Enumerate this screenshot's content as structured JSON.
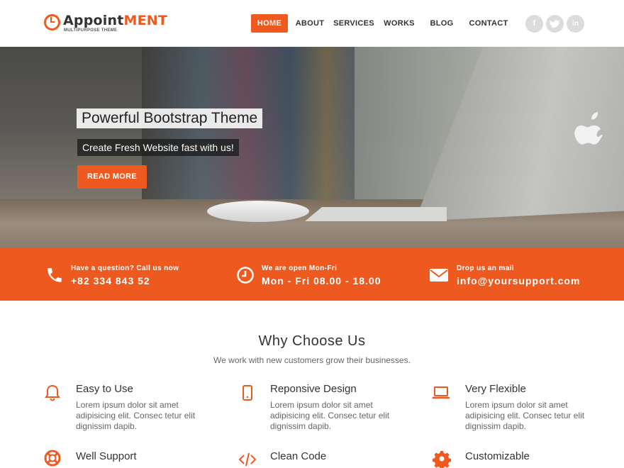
{
  "brand": {
    "name_part1": "Appoint",
    "name_part2": "ment",
    "tagline": "MULTIPURPOSE THEME",
    "accent": "#ee591f"
  },
  "nav": {
    "items": [
      "HOME",
      "ABOUT",
      "SERVICES",
      "WORKS",
      "BLOG",
      "CONTACT"
    ],
    "active": "HOME"
  },
  "social": [
    {
      "icon": "facebook-icon",
      "glyph": "f"
    },
    {
      "icon": "twitter-icon",
      "glyph": "t"
    },
    {
      "icon": "linkedin-icon",
      "glyph": "in"
    }
  ],
  "hero": {
    "title": "Powerful Bootstrap Theme",
    "subtitle": "Create Fresh Website fast with us!",
    "button": "READ MORE"
  },
  "info": [
    {
      "icon": "phone-icon",
      "label": "Have a question? Call us now",
      "value": "+82 334 843 52"
    },
    {
      "icon": "clock-icon",
      "label": "We are open Mon-Fri",
      "value": "Mon - Fri 08.00 - 18.00"
    },
    {
      "icon": "mail-icon",
      "label": "Drop us an mail",
      "value": "info@yoursupport.com"
    }
  ],
  "why": {
    "title": "Why Choose Us",
    "subtitle": "We work with new customers grow their businesses.",
    "features": [
      {
        "icon": "bell-icon",
        "title": "Easy to Use",
        "text": "Lorem ipsum dolor sit amet adipisicing elit. Consec tetur elit dignissim dapib."
      },
      {
        "icon": "mobile-icon",
        "title": "Reponsive Design",
        "text": "Lorem ipsum dolor sit amet adipisicing elit. Consec tetur elit dignissim dapib."
      },
      {
        "icon": "laptop-icon",
        "title": "Very Flexible",
        "text": "Lorem ipsum dolor sit amet adipisicing elit. Consec tetur elit dignissim dapib."
      },
      {
        "icon": "lifebuoy-icon",
        "title": "Well Support",
        "text": ""
      },
      {
        "icon": "code-icon",
        "title": "Clean Code",
        "text": ""
      },
      {
        "icon": "gear-icon",
        "title": "Customizable",
        "text": ""
      }
    ]
  }
}
